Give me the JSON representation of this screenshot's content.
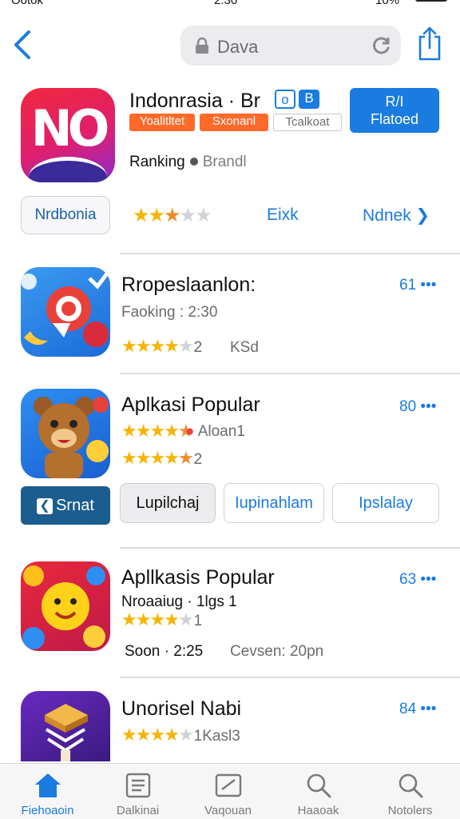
{
  "status_bar": {
    "carrier": "Ootok",
    "time": "2:30",
    "battery_pct": "10%",
    "battery_level": 0.25
  },
  "nav": {
    "search_text": "Dava",
    "icons": [
      "back-chevron-icon",
      "lock-icon",
      "reload-icon",
      "share-icon"
    ]
  },
  "hero": {
    "icon_text": "NO",
    "title": "Indonrasia · Br",
    "badges": [
      "o",
      "B"
    ],
    "get_button": [
      "R/I",
      "Flatoed"
    ],
    "tags": [
      "Yoalitltet",
      "Sxonanl",
      "Tcalkoat"
    ],
    "ranking_label": "Ranking",
    "ranking_value": "Brandl",
    "chip_label": "Nrdbonia",
    "rating_stars": 2.5,
    "link_1": "Eixk",
    "link_2": "Ndnek ❯"
  },
  "apps": [
    {
      "title": "Rropeslaanlon:",
      "subtitle": "Faoking : 2:30",
      "rating_stars": 4,
      "rating_count": "2",
      "meta": "KSd",
      "rank": "61 •••",
      "icon": "chat-bubble-icon"
    },
    {
      "title": "Aplkasi Popular",
      "subtitle": "Aloan1",
      "rating_stars": 4.5,
      "rating_count": "2",
      "meta": "",
      "rank": "80 •••",
      "icon": "bear-mascot-icon"
    },
    {
      "title": "Apllkasis Popular",
      "subtitle": "Nroaaiug · 1lgs 1",
      "rating_stars": 4,
      "rating_count": "1",
      "meta_left": "Soon · 2:25",
      "meta_right": "Cevsen: 20pn",
      "rank": "63 •••",
      "icon": "emoji-face-icon"
    },
    {
      "title": "Unorisel Nabi",
      "subtitle": "",
      "rating_stars": 4,
      "rating_count": "1Kasl3",
      "rank": "84 •••",
      "icon": "stack-books-icon"
    }
  ],
  "chips": [
    "Srnat",
    "Lupilchaj",
    "Iupinahlam",
    "Ipslalay"
  ],
  "tabs": [
    {
      "label": "Fiehoaoin",
      "icon": "home-icon",
      "active": true
    },
    {
      "label": "Dalkinai",
      "icon": "list-icon",
      "active": false
    },
    {
      "label": "Vaqouan",
      "icon": "edit-icon",
      "active": false
    },
    {
      "label": "Haaoak",
      "icon": "search-icon",
      "active": false
    },
    {
      "label": "Notolers",
      "icon": "search-icon",
      "active": false
    }
  ],
  "colors": {
    "accent": "#1a7be0",
    "star": "#f5b400",
    "tag_orange": "#ff6a2a"
  }
}
